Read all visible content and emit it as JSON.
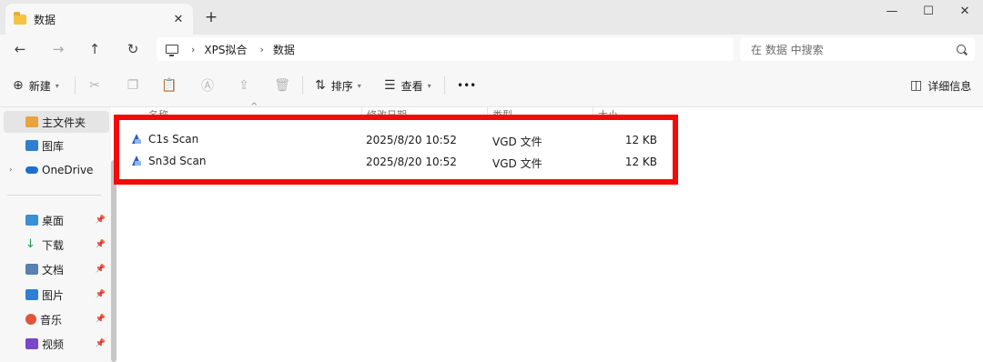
{
  "window": {
    "tab_title": "数据",
    "new_tab": "+",
    "minimize": "—",
    "maximize": "☐",
    "close": "✕"
  },
  "nav": {
    "back": "←",
    "forward": "→",
    "up": "↑",
    "refresh": "↻",
    "breadcrumb": [
      "XPS拟合",
      "数据"
    ],
    "search_placeholder": "在 数据 中搜索"
  },
  "toolbar": {
    "new_label": "新建",
    "sort_label": "排序",
    "view_label": "查看",
    "more_label": "•••",
    "details_label": "详细信息"
  },
  "sidebar": {
    "items": [
      {
        "label": "主文件夹",
        "color": "#e8a33a"
      },
      {
        "label": "图库",
        "color": "#2d7fd3"
      },
      {
        "label": "OneDrive",
        "color": "#1f6fd1"
      },
      {
        "label": "桌面",
        "color": "#3a8fd6"
      },
      {
        "label": "下载",
        "color": "#2a9a5a"
      },
      {
        "label": "文档",
        "color": "#5a7fb0"
      },
      {
        "label": "图片",
        "color": "#2d7fd3"
      },
      {
        "label": "音乐",
        "color": "#e0553b"
      },
      {
        "label": "视频",
        "color": "#7b47c9"
      }
    ]
  },
  "columns": {
    "name": "名称",
    "date": "修改日期",
    "type": "类型",
    "size": "大小"
  },
  "files": [
    {
      "name": "C1s Scan",
      "date": "2025/8/20 10:52",
      "type": "VGD 文件",
      "size": "12 KB"
    },
    {
      "name": "Sn3d Scan",
      "date": "2025/8/20 10:52",
      "type": "VGD 文件",
      "size": "12 KB"
    }
  ],
  "colors": {
    "highlight": "#f40a0a",
    "accent": "#2a5fbf"
  }
}
